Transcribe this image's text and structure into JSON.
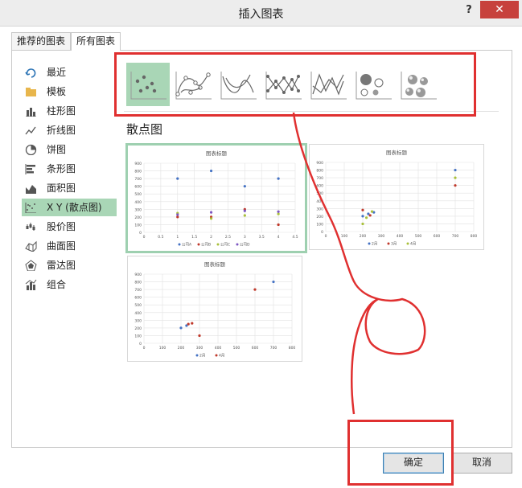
{
  "window": {
    "title": "插入图表",
    "help_label": "?",
    "close_label": "✕"
  },
  "tabs": [
    {
      "label": "推荐的图表"
    },
    {
      "label": "所有图表"
    }
  ],
  "sidebar": {
    "items": [
      {
        "label": "最近",
        "icon": "recent-icon"
      },
      {
        "label": "模板",
        "icon": "folder-icon"
      },
      {
        "label": "柱形图",
        "icon": "column-chart-icon"
      },
      {
        "label": "折线图",
        "icon": "line-chart-icon"
      },
      {
        "label": "饼图",
        "icon": "pie-chart-icon"
      },
      {
        "label": "条形图",
        "icon": "bar-chart-icon"
      },
      {
        "label": "面积图",
        "icon": "area-chart-icon"
      },
      {
        "label": "X Y (散点图)",
        "icon": "scatter-chart-icon"
      },
      {
        "label": "股价图",
        "icon": "stock-chart-icon"
      },
      {
        "label": "曲面图",
        "icon": "surface-chart-icon"
      },
      {
        "label": "雷达图",
        "icon": "radar-chart-icon"
      },
      {
        "label": "组合",
        "icon": "combo-chart-icon"
      }
    ],
    "selected": "X Y (散点图)"
  },
  "subtypes": {
    "items": [
      "scatter-icon",
      "scatter-smooth-lines-markers-icon",
      "scatter-smooth-lines-icon",
      "scatter-straight-lines-markers-icon",
      "scatter-straight-lines-icon",
      "bubble-icon",
      "3d-bubble-icon"
    ],
    "selected_index": 0
  },
  "section_title": "散点图",
  "previews": [
    {
      "title": "图表标题",
      "chart_data": {
        "type": "scatter",
        "title": "图表标题",
        "x_ticks": [
          "0",
          "0.5",
          "1",
          "1.5",
          "2",
          "2.5",
          "3",
          "3.5",
          "4",
          "4.5"
        ],
        "y_ticks": [
          "0",
          "100",
          "200",
          "300",
          "400",
          "500",
          "600",
          "700",
          "800",
          "900"
        ],
        "xlim": [
          0,
          4.5
        ],
        "ylim": [
          0,
          900
        ],
        "series": [
          {
            "name": "公司A",
            "color": "#4472c4",
            "points": [
              [
                1,
                700
              ],
              [
                2,
                800
              ],
              [
                3,
                600
              ],
              [
                4,
                700
              ]
            ]
          },
          {
            "name": "公司B",
            "color": "#c0392b",
            "points": [
              [
                1,
                200
              ],
              [
                2,
                200
              ],
              [
                3,
                300
              ],
              [
                4,
                100
              ]
            ]
          },
          {
            "name": "公司C",
            "color": "#a9c03b",
            "points": [
              [
                1,
                250
              ],
              [
                2,
                180
              ],
              [
                3,
                220
              ],
              [
                4,
                240
              ]
            ]
          },
          {
            "name": "公司D",
            "color": "#7e57c2",
            "points": [
              [
                1,
                230
              ],
              [
                2,
                260
              ],
              [
                3,
                280
              ],
              [
                4,
                270
              ]
            ]
          }
        ]
      }
    },
    {
      "title": "图表标题",
      "chart_data": {
        "type": "scatter",
        "title": "图表标题",
        "x_ticks": [
          "0",
          "100",
          "200",
          "300",
          "400",
          "500",
          "600",
          "700",
          "800"
        ],
        "y_ticks": [
          "0",
          "100",
          "200",
          "300",
          "400",
          "500",
          "600",
          "700",
          "800",
          "900"
        ],
        "xlim": [
          0,
          800
        ],
        "ylim": [
          0,
          900
        ],
        "series": [
          {
            "name": "2月",
            "color": "#4472c4",
            "points": [
              [
                200,
                200
              ],
              [
                230,
                230
              ],
              [
                260,
                250
              ],
              [
                700,
                800
              ]
            ]
          },
          {
            "name": "3月",
            "color": "#c0392b",
            "points": [
              [
                200,
                280
              ],
              [
                240,
                210
              ],
              [
                700,
                600
              ]
            ]
          },
          {
            "name": "4月",
            "color": "#a9c03b",
            "points": [
              [
                200,
                100
              ],
              [
                220,
                180
              ],
              [
                250,
                260
              ],
              [
                700,
                700
              ]
            ]
          }
        ]
      }
    },
    {
      "title": "图表标题",
      "chart_data": {
        "type": "scatter",
        "title": "图表标题",
        "x_ticks": [
          "0",
          "100",
          "200",
          "300",
          "400",
          "500",
          "600",
          "700",
          "800"
        ],
        "y_ticks": [
          "0",
          "100",
          "200",
          "300",
          "400",
          "500",
          "600",
          "700",
          "800",
          "900"
        ],
        "xlim": [
          0,
          800
        ],
        "ylim": [
          0,
          900
        ],
        "series": [
          {
            "name": "2月",
            "color": "#4472c4",
            "points": [
              [
                200,
                200
              ],
              [
                230,
                230
              ],
              [
                700,
                800
              ]
            ]
          },
          {
            "name": "4月",
            "color": "#c0392b",
            "points": [
              [
                240,
                250
              ],
              [
                260,
                260
              ],
              [
                300,
                100
              ],
              [
                600,
                700
              ]
            ]
          }
        ]
      }
    }
  ],
  "buttons": {
    "ok_label": "确定",
    "cancel_label": "取消"
  },
  "colors": {
    "selection": "#a9d6b6",
    "annotation": "#e03030",
    "close": "#c7413c"
  }
}
